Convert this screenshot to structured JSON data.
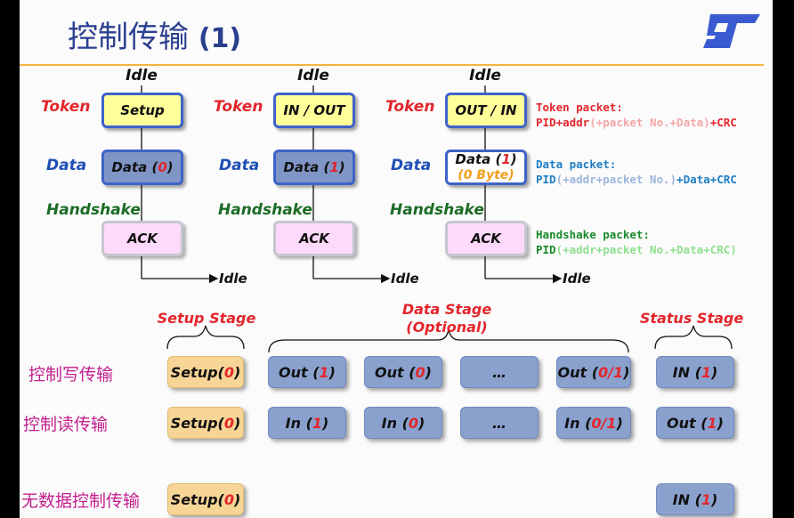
{
  "slide": {
    "title_cn": "控制传输",
    "title_num": "(1)",
    "logo": "st-logo"
  },
  "columns": [
    {
      "idle_top": "Idle",
      "labels": {
        "token": "Token",
        "data": "Data",
        "handshake": "Handshake"
      },
      "token_box": "Setup",
      "data_box": {
        "main": "Data (",
        "num": "0",
        "close": ")",
        "sub": ""
      },
      "ack_box": "ACK",
      "idle_end": "Idle"
    },
    {
      "idle_top": "Idle",
      "labels": {
        "token": "Token",
        "data": "Data",
        "handshake": "Handshake"
      },
      "token_box": "IN / OUT",
      "data_box": {
        "main": "Data (",
        "num": "1",
        "close": ")",
        "sub": ""
      },
      "ack_box": "ACK",
      "idle_end": "Idle"
    },
    {
      "idle_top": "Idle",
      "labels": {
        "token": "Token",
        "data": "Data",
        "handshake": "Handshake"
      },
      "token_box": "OUT / IN",
      "data_box": {
        "main": "Data (",
        "num": "1",
        "close": ")",
        "sub": "(0 Byte)"
      },
      "ack_box": "ACK",
      "idle_end": "Idle"
    }
  ],
  "packet_descriptions": {
    "token": {
      "title": "Token packet:",
      "p1": "PID+addr",
      "p2": "(+packet No.+Data)",
      "p3": "+CRC"
    },
    "data": {
      "title": "Data packet:",
      "p1": "PID",
      "p2": "(+addr+packet No.)",
      "p3": "+Data+CRC"
    },
    "handshake": {
      "title": "Handshake packet:",
      "p1": "PID",
      "p2": "(+addr+packet No.+Data+CRC)"
    }
  },
  "stages": {
    "setup": "Setup Stage",
    "data_line1": "Data Stage",
    "data_line2": "(Optional)",
    "status": "Status Stage"
  },
  "rows": [
    {
      "label": "控制写传输",
      "setup": {
        "text": "Setup(",
        "num": "0",
        "close": ")"
      },
      "data": [
        {
          "text": "Out (",
          "num": "1",
          "close": ")"
        },
        {
          "text": "Out (",
          "num": "0",
          "close": ")"
        },
        {
          "text": "…",
          "num": "",
          "close": ""
        },
        {
          "text": "Out (",
          "num": "0/1",
          "close": ")"
        }
      ],
      "status": {
        "text": "IN (",
        "num": "1",
        "close": ")"
      }
    },
    {
      "label": "控制读传输",
      "setup": {
        "text": "Setup(",
        "num": "0",
        "close": ")"
      },
      "data": [
        {
          "text": "In (",
          "num": "1",
          "close": ")"
        },
        {
          "text": "In (",
          "num": "0",
          "close": ")"
        },
        {
          "text": "…",
          "num": "",
          "close": ""
        },
        {
          "text": "In (",
          "num": "0/1",
          "close": ")"
        }
      ],
      "status": {
        "text": "Out (",
        "num": "1",
        "close": ")"
      }
    },
    {
      "label": "无数据控制传输",
      "setup": {
        "text": "Setup(",
        "num": "0",
        "close": ")"
      },
      "data": [],
      "status": {
        "text": "IN (",
        "num": "1",
        "close": ")"
      }
    }
  ],
  "colors": {
    "accent_line": "#f0b540",
    "title": "#2b3f8f",
    "logo": "#3a5bd0"
  }
}
